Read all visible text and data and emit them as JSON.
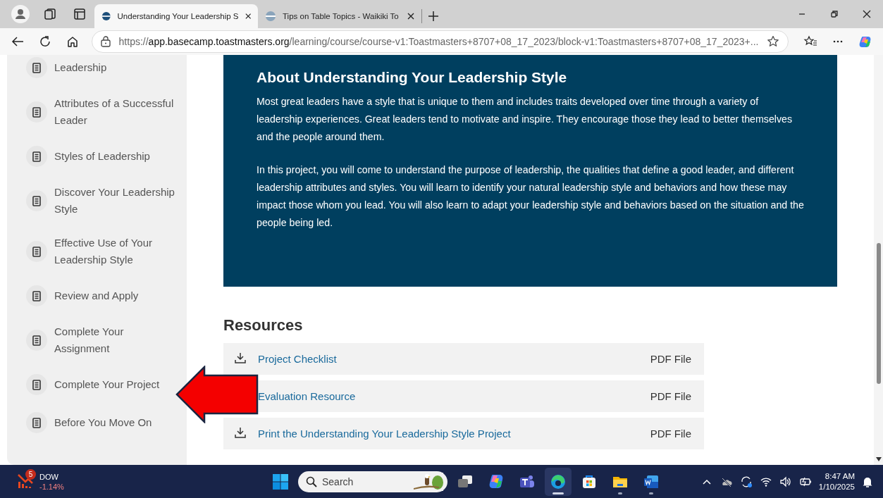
{
  "browser": {
    "tabs": [
      {
        "title": "Understanding Your Leadership S",
        "selected": true
      },
      {
        "title": "Tips on Table Topics - Waikiki To",
        "selected": false
      }
    ],
    "url": {
      "scheme": "https://",
      "host": "app.basecamp.toastmasters.org",
      "path": "/learning/course/course-v1:Toastmasters+8707+08_17_2023/block-v1:Toastmasters+8707+08_17_2023+..."
    }
  },
  "sidebar": {
    "items": [
      {
        "label": "Leadership"
      },
      {
        "label": "Attributes of a Successful Leader"
      },
      {
        "label": "Styles of Leadership"
      },
      {
        "label": "Discover Your Leadership Style"
      },
      {
        "label": "Effective Use of Your Leadership Style"
      },
      {
        "label": "Review and Apply"
      },
      {
        "label": "Complete Your Assignment"
      },
      {
        "label": "Complete Your Project"
      },
      {
        "label": "Before You Move On"
      }
    ]
  },
  "about": {
    "title": "About Understanding Your Leadership Style",
    "paragraphs": [
      "Most great leaders have a style that is unique to them and includes traits developed over time through a variety of leadership experiences. Great leaders tend to motivate and inspire. They encourage those they lead to better themselves and the people around them.",
      "In this project, you will come to understand the purpose of leadership, the qualities that define a good leader, and different leadership attributes and styles. You will learn to identify your natural leadership style and behaviors and how these may impact those whom you lead. You will also learn to adapt your leadership style and behaviors based on the situation and the people being led."
    ]
  },
  "resources": {
    "title": "Resources",
    "items": [
      {
        "title": "Project Checklist",
        "file_type": "PDF File",
        "download_icon": true
      },
      {
        "title": "Evaluation Resource",
        "file_type": "PDF File",
        "download_icon": false
      },
      {
        "title": "Print the Understanding Your Leadership Style Project",
        "file_type": "PDF File",
        "download_icon": true
      }
    ]
  },
  "annotation_arrow": true,
  "taskbar": {
    "widget": {
      "badge": "5",
      "label": "DOW",
      "change": "-1.14%"
    },
    "search": {
      "placeholder": "Search"
    },
    "apps": [
      {
        "kind": "taskview",
        "running": false,
        "selected": false
      },
      {
        "kind": "copilot",
        "running": false,
        "selected": false
      },
      {
        "kind": "teams",
        "running": false,
        "selected": false
      },
      {
        "kind": "edge",
        "running": true,
        "selected": true
      },
      {
        "kind": "store",
        "running": false,
        "selected": false
      },
      {
        "kind": "explorer",
        "running": true,
        "selected": false
      },
      {
        "kind": "word",
        "running": true,
        "selected": false
      }
    ],
    "time": "8:47 AM",
    "date": "1/10/2025"
  }
}
